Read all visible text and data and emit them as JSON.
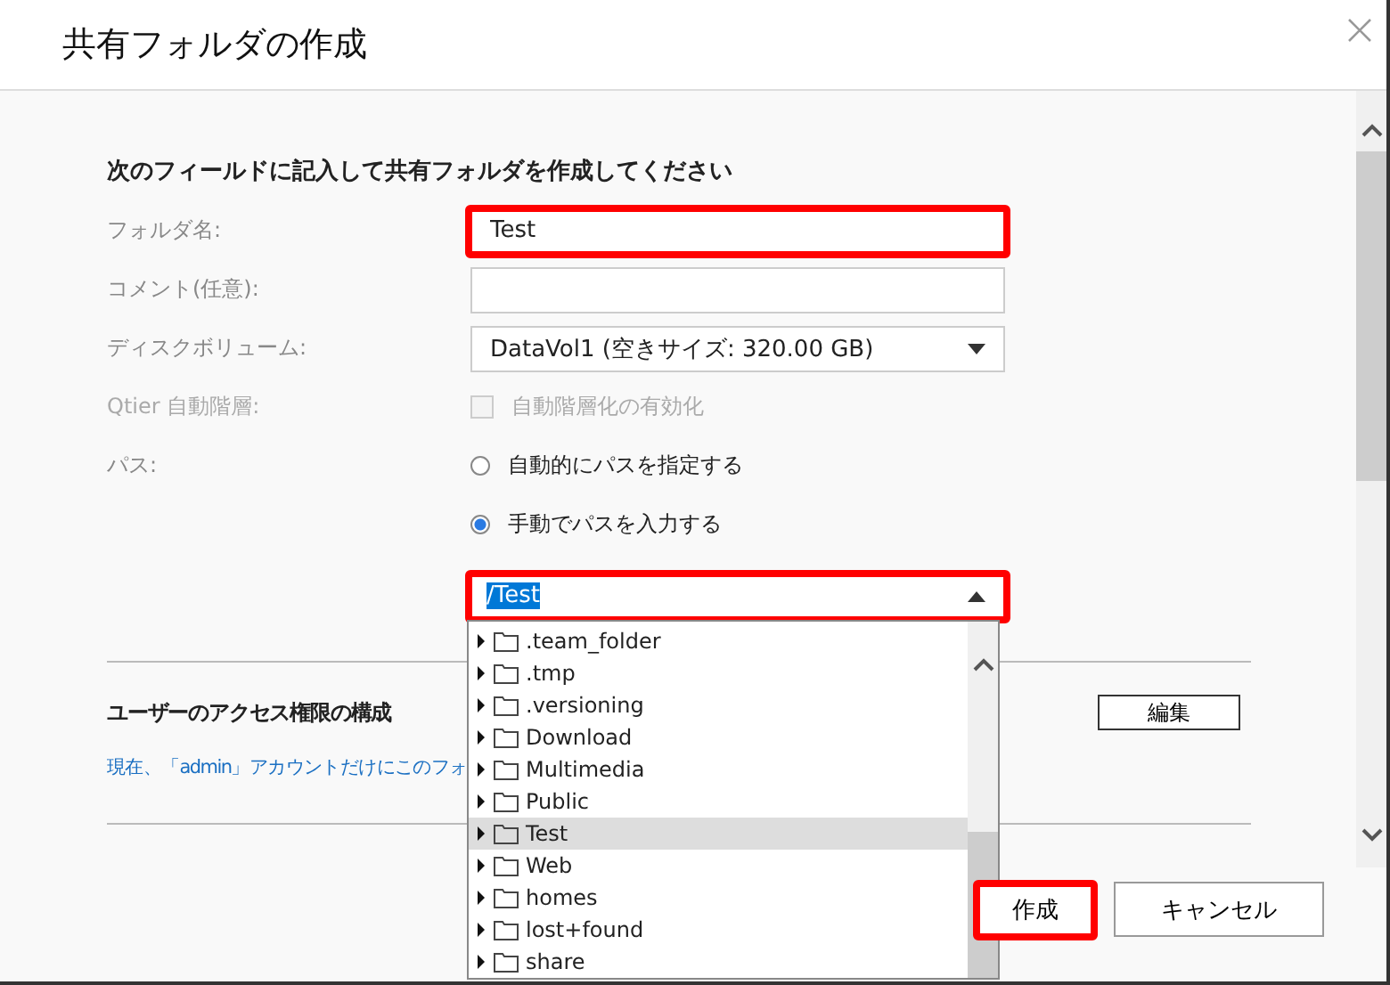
{
  "dialog": {
    "title": "共有フォルダの作成"
  },
  "form": {
    "heading": "次のフィールドに記入して共有フォルダを作成してください",
    "fields": [
      {
        "kind": "text",
        "label": "フォルダ名:",
        "value": "Test",
        "highlighted": true
      },
      {
        "kind": "text",
        "label": "コメント(任意):",
        "highlighted": false
      },
      {
        "kind": "select",
        "label": "ディスクボリューム:",
        "value": "DataVol1 (空きサイズ: 320.00 GB)"
      },
      {
        "kind": "checkbox",
        "label": "Qtier 自動階層:",
        "option": "自動階層化の有効化",
        "checked": false,
        "disabled": true
      },
      {
        "kind": "radio",
        "label": "パス:",
        "options": [
          {
            "label": "自動的にパスを指定する",
            "selected": false
          },
          {
            "label": "手動でパスを入力する",
            "selected": true
          }
        ]
      },
      {
        "kind": "combo",
        "value": "/Test",
        "highlighted": true,
        "expanded": true,
        "items": [
          {
            "label": ".team_folder",
            "selected": false
          },
          {
            "label": ".tmp",
            "selected": false
          },
          {
            "label": ".versioning",
            "selected": false
          },
          {
            "label": "Download",
            "selected": false
          },
          {
            "label": "Multimedia",
            "selected": false
          },
          {
            "label": "Public",
            "selected": false
          },
          {
            "label": "Test",
            "selected": true
          },
          {
            "label": "Web",
            "selected": false
          },
          {
            "label": "homes",
            "selected": false
          },
          {
            "label": "lost+found",
            "selected": false
          },
          {
            "label": "share",
            "selected": false
          }
        ]
      }
    ]
  },
  "access": {
    "heading": "ユーザーのアクセス権限の構成",
    "edit_button": "編集",
    "note": "現在、「admin」アカウントだけにこのフォ"
  },
  "footer": {
    "buttons": [
      {
        "label": "作成",
        "highlighted": true
      },
      {
        "label": "キャンセル",
        "highlighted": false
      }
    ]
  }
}
